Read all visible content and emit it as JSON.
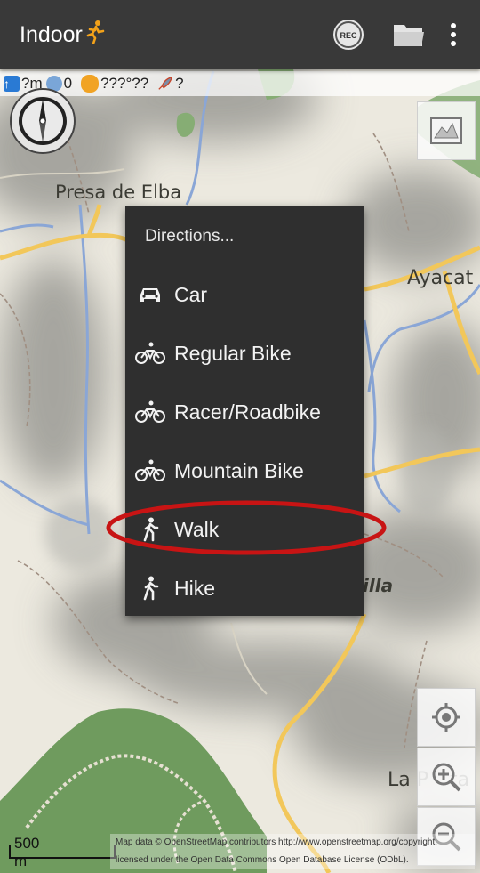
{
  "app": {
    "title": "Indoor"
  },
  "toolbar": {
    "rec_label": "REC"
  },
  "status": {
    "altitude": "?m",
    "satellites": "0",
    "coords": "???°??",
    "speed": "?"
  },
  "map": {
    "labels": {
      "presa": "Presa de Elba",
      "ayacat": "Ayacat",
      "illa": "illa",
      "la_pasta": "La P",
      "la_pasta_tail": "ta"
    }
  },
  "menu": {
    "title": "Directions...",
    "items": [
      {
        "label": "Car",
        "icon": "car-icon"
      },
      {
        "label": "Regular Bike",
        "icon": "bike-icon"
      },
      {
        "label": "Racer/Roadbike",
        "icon": "bike-icon"
      },
      {
        "label": "Mountain Bike",
        "icon": "bike-icon"
      },
      {
        "label": "Walk",
        "icon": "walk-icon"
      },
      {
        "label": "Hike",
        "icon": "walk-icon"
      }
    ]
  },
  "scale": {
    "label": "500 m"
  },
  "attribution": {
    "line1": "Map data © OpenStreetMap contributors http://www.openstreetmap.org/copyright.",
    "line2": "licensed under the Open Data Commons Open Database License (ODbL)."
  },
  "colors": {
    "toolbar": "#393939",
    "menu_bg": "#2f2f2f",
    "highlight": "#c81414",
    "forest": "#6c9a5c",
    "road": "#f2c75a",
    "water": "#8aa6d6"
  }
}
